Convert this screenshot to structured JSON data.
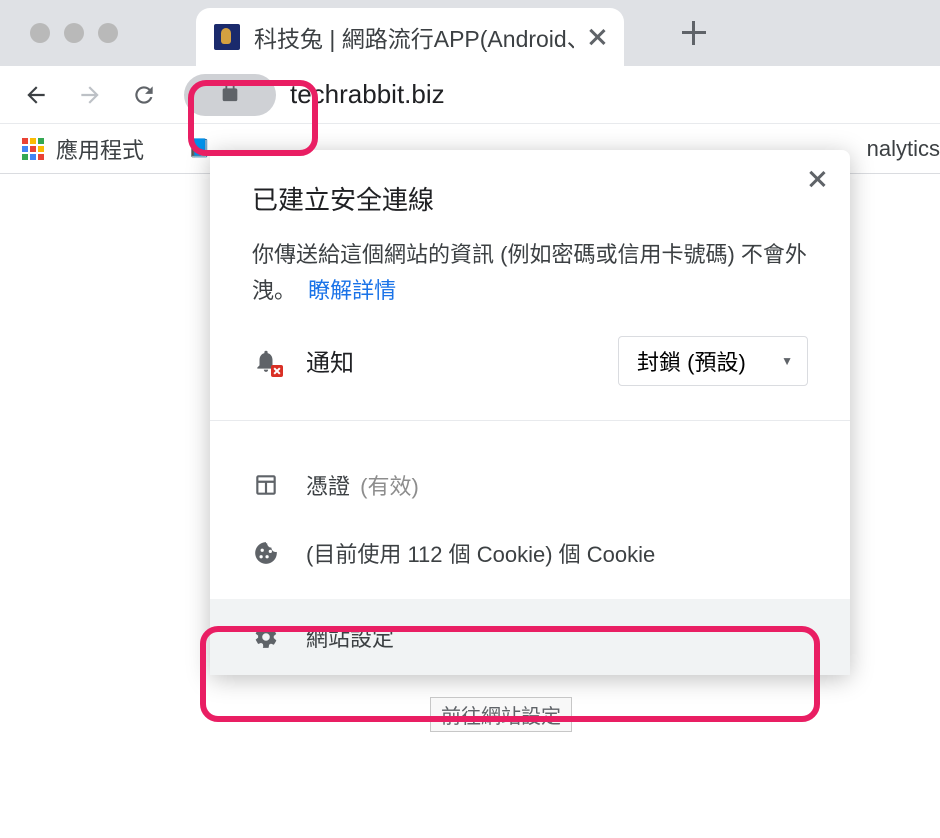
{
  "tab": {
    "title": "科技兔 | 網路流行APP(Android、"
  },
  "address": {
    "url": "techrabbit.biz"
  },
  "bookmarks": {
    "apps_label": "應用程式",
    "partial_right": "nalytics"
  },
  "popup": {
    "title": "已建立安全連線",
    "description": "你傳送給這個網站的資訊 (例如密碼或信用卡號碼) 不會外洩。",
    "learn_more": "瞭解詳情",
    "notification": {
      "label": "通知",
      "value": "封鎖 (預設)"
    },
    "certificate": {
      "label": "憑證",
      "status": "(有效)"
    },
    "cookies": {
      "label": "(目前使用 112 個 Cookie) 個 Cookie"
    },
    "site_settings": {
      "label": "網站設定"
    }
  },
  "tooltip": {
    "text": "前往網站設定"
  }
}
